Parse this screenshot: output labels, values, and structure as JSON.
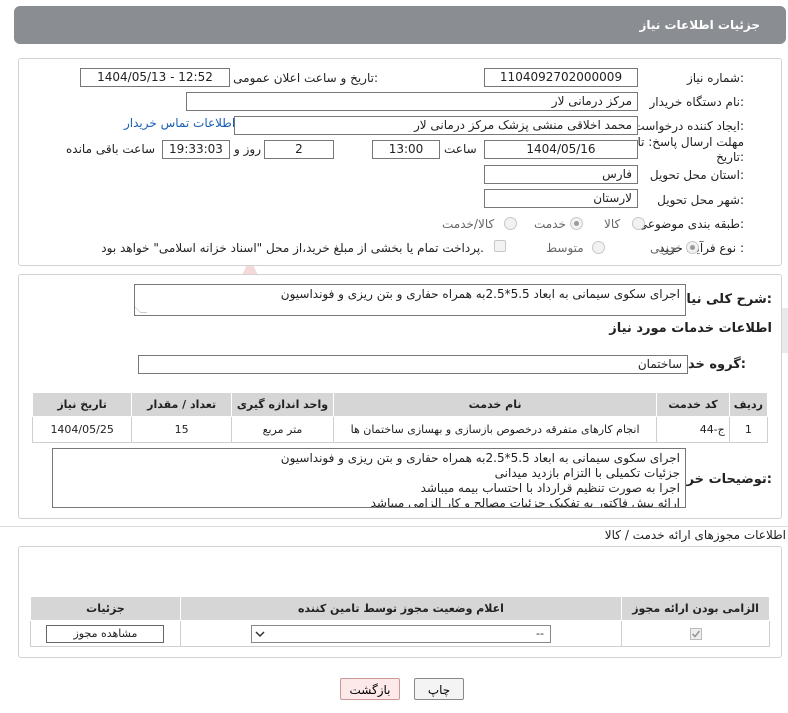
{
  "header": {
    "title": "جزئیات اطلاعات نیاز"
  },
  "form": {
    "need_number": {
      "label": "شماره نیاز:",
      "value": "1104092702000009"
    },
    "announce_datetime": {
      "label": "تاریخ و ساعت اعلان عمومی:",
      "value": "1404/05/13 - 12:52"
    },
    "buyer_org": {
      "label": "نام دستگاه خریدار:",
      "value": "مرکز درمانی لار"
    },
    "requester": {
      "label": "ایجاد کننده درخواست:",
      "value": "محمد  اخلاقی منشی پزشک مرکز درمانی لار"
    },
    "contact_link": "اطلاعات تماس خریدار",
    "deadline": {
      "label_line1": "مهلت ارسال پاسخ: تا",
      "label_line2": "تاریخ:",
      "date": "1404/05/16",
      "time_label": "ساعت",
      "time": "13:00",
      "days": "2",
      "days_label": "روز و",
      "remaining": "19:33:03",
      "remaining_label": "ساعت باقی مانده"
    },
    "province": {
      "label": "استان محل تحویل:",
      "value": "فارس"
    },
    "city": {
      "label": "شهر محل تحویل:",
      "value": "لارستان"
    },
    "category": {
      "label": "طبقه بندی موضوعی:",
      "options": [
        "کالا",
        "خدمت",
        "کالا/خدمت"
      ],
      "selected": "خدمت"
    },
    "purchase_type": {
      "label": "نوع فرآیند خرید :",
      "options": [
        "جزیی",
        "متوسط"
      ],
      "selected": "جزیی",
      "payment_note": "پرداخت تمام یا بخشی از مبلغ خرید،از محل \"اسناد خزانه اسلامی\" خواهد بود."
    }
  },
  "summary": {
    "label": "شرح کلی نیاز:",
    "value": "اجرای سکوی سیمانی به ابعاد 5.5*2.5به همراه حفاری و بتن ریزی و فونداسیون"
  },
  "services_title": "اطلاعات خدمات مورد نیاز",
  "service_group": {
    "label": "گروه خدمت:",
    "value": "ساختمان"
  },
  "services_table": {
    "headers": [
      "ردیف",
      "کد خدمت",
      "نام خدمت",
      "واحد اندازه گیری",
      "تعداد / مقدار",
      "تاریخ نیاز"
    ],
    "rows": [
      [
        "1",
        "ج-44",
        "انجام کارهای متفرقه درخصوص بازسازی و بهسازی ساختمان ها",
        "متر مربع",
        "15",
        "1404/05/25"
      ]
    ]
  },
  "buyer_notes": {
    "label": "توضیحات خریدار:",
    "lines": [
      "اجرای سکوی سیمانی به ابعاد 5.5*2.5به همراه حفاری و بتن ریزی و فونداسیون",
      "جزئیات تکمیلی با التزام بازدید میدانی",
      "اجرا به صورت تنظیم قرارداد با احتساب بیمه میباشد",
      "ارائه پیش فاکتور به تفکیک جزئیات مصالح و کار الزامی میباشد"
    ]
  },
  "permits": {
    "title": "اطلاعات مجوزهای ارائه خدمت / کالا",
    "headers": [
      "الزامی بودن ارائه مجوز",
      "اعلام وضعیت مجوز توسط تامین کننده",
      "جزئیات"
    ],
    "select_value": "--",
    "view_button": "مشاهده مجوز"
  },
  "buttons": {
    "print": "چاپ",
    "back": "بازگشت"
  },
  "watermark": "AriaTender.net"
}
